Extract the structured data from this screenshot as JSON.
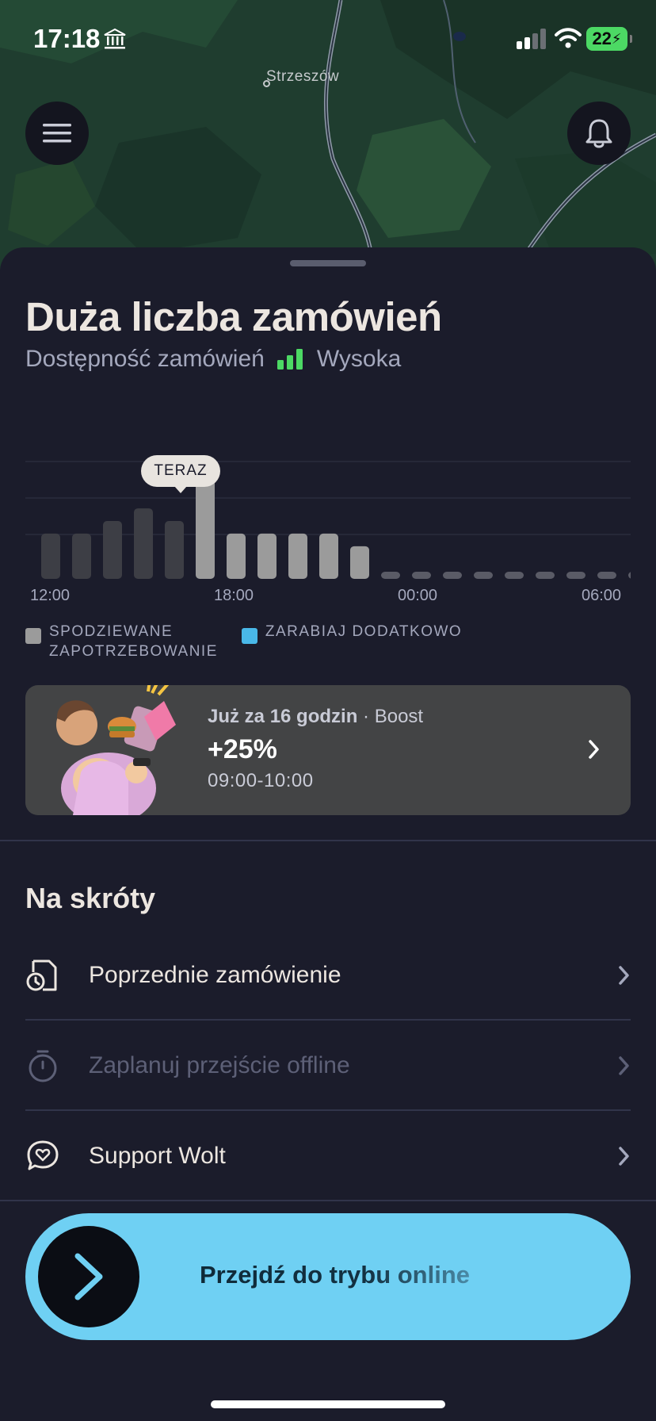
{
  "status_bar": {
    "time": "17:18",
    "battery": "22"
  },
  "map": {
    "place_label": "Strzeszów"
  },
  "header": {
    "title": "Duża liczba zamówień",
    "availability_label": "Dostępność zamówień",
    "availability_value": "Wysoka",
    "availability_color": "#4cd964"
  },
  "chart_data": {
    "type": "bar",
    "now_marker": "TERAZ",
    "now_index": 5,
    "x_tick_labels": [
      "12:00",
      "18:00",
      "00:00",
      "06:00"
    ],
    "values": [
      1,
      1,
      1.3,
      1.6,
      1.3,
      2.6,
      1,
      1,
      1,
      1,
      0.7,
      0.05,
      0.05,
      0.05,
      0.05,
      0.05,
      0.05,
      0.05,
      0.05,
      0.05
    ],
    "legend": [
      {
        "label": "SPODZIEWANE ZAPOTRZEBOWANIE",
        "color": "#9b9b9b"
      },
      {
        "label": "ZARABIAJ DODATKOWO",
        "color": "#49b8e8"
      }
    ],
    "grid": true
  },
  "legend": {
    "demand_line1": "SPODZIEWANE",
    "demand_line2": "ZAPOTRZEBOWANIE",
    "extra": "ZARABIAJ DODATKOWO"
  },
  "boost": {
    "when": "Już za 16 godzin",
    "separator": "·",
    "type": "Boost",
    "value": "+25%",
    "hours": "09:00-10:00"
  },
  "shortcuts": {
    "title": "Na skróty",
    "items": [
      {
        "label": "Poprzednie zamówienie",
        "icon": "receipt-clock-icon",
        "enabled": true
      },
      {
        "label": "Zaplanuj przejście offline",
        "icon": "timer-icon",
        "enabled": false
      },
      {
        "label": "Support Wolt",
        "icon": "heart-chat-icon",
        "enabled": true
      }
    ]
  },
  "online_slider": {
    "label": "Przejdź do trybu online"
  }
}
